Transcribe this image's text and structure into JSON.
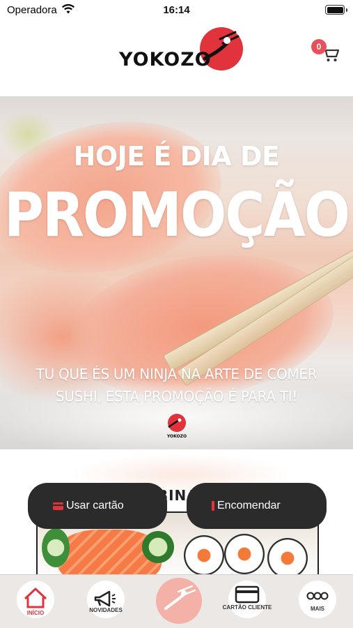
{
  "status_bar": {
    "carrier": "Operadora",
    "time": "16:14"
  },
  "header": {
    "brand": "YOKOZO",
    "cart_count": "0",
    "accent": "#e0333c"
  },
  "banner": {
    "line1": "HOJE É DIA DE",
    "line2": "PROMOÇÃO",
    "subtitle_line1": "TU QUE ÉS UM NINJA NA ARTE DE COMER",
    "subtitle_line2": "SUSHI, ESTA PROMOÇÃO É PARA TI!",
    "mini_brand": "YOKOZO"
  },
  "section": {
    "title": "COMBINADOS"
  },
  "actions": {
    "use_card": "Usar cartão",
    "order": "Encomendar"
  },
  "tabbar": {
    "items": [
      {
        "label": "INÍCIO",
        "icon": "home-icon",
        "active": true
      },
      {
        "label": "NOVIDADES",
        "icon": "megaphone-icon"
      },
      {
        "label": "",
        "icon": "brand-logo-icon"
      },
      {
        "label": "CARTÃO CLIENTE",
        "icon": "card-icon"
      },
      {
        "label": "MAIS",
        "icon": "more-dots-icon"
      }
    ]
  }
}
